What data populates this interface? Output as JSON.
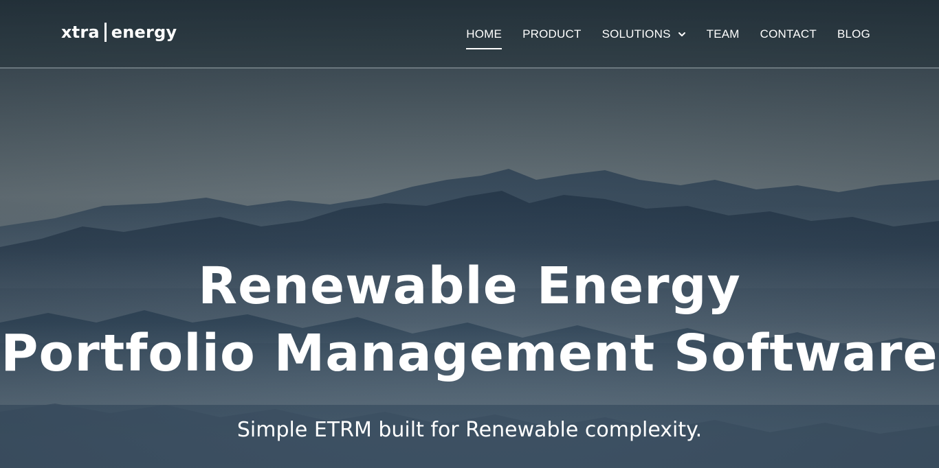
{
  "brand": {
    "logo_left": "xtra",
    "logo_right": "energy"
  },
  "nav": {
    "items": [
      {
        "label": "HOME",
        "active": true
      },
      {
        "label": "PRODUCT"
      },
      {
        "label": "SOLUTIONS",
        "has_dropdown": true
      },
      {
        "label": "TEAM"
      },
      {
        "label": "CONTACT"
      },
      {
        "label": "BLOG"
      }
    ]
  },
  "hero": {
    "title_line1": "Renewable Energy",
    "title_line2": "Portfolio Management Software",
    "subtitle": "Simple ETRM built for Renewable complexity."
  },
  "icons": {
    "dropdown": "chevron-down-icon"
  },
  "colors": {
    "text": "#ffffff",
    "background": "#4a5a66"
  }
}
